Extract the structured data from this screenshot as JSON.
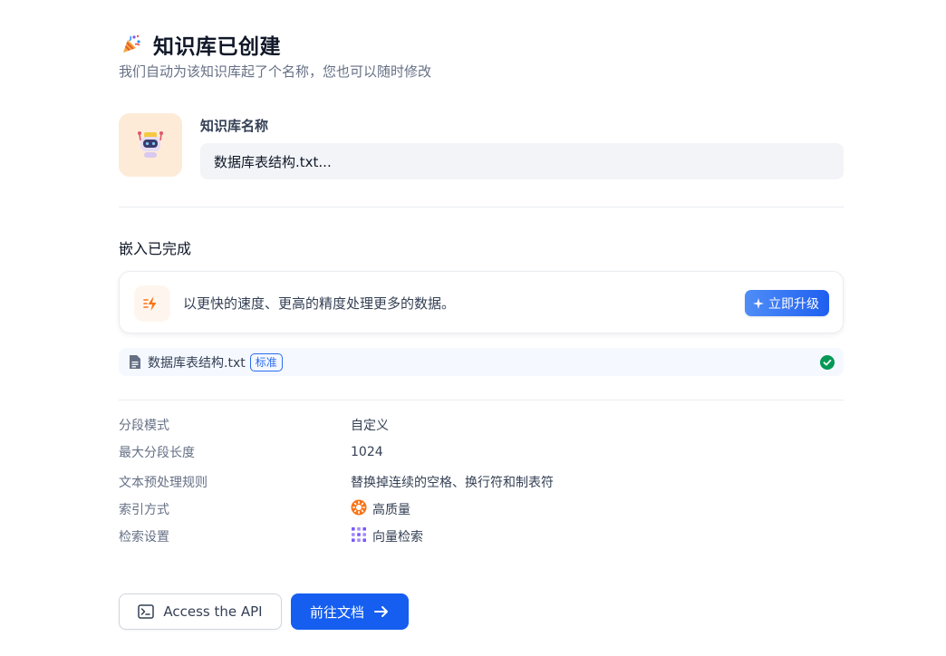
{
  "header": {
    "title": "知识库已创建",
    "subtitle": "我们自动为该知识库起了个名称，您也可以随时修改",
    "icon": "party-popper-icon"
  },
  "name_section": {
    "label": "知识库名称",
    "value": "数据库表结构.txt...",
    "avatar_icon": "robot-icon",
    "avatar_bg": "#fdebd8"
  },
  "embedding": {
    "title": "嵌入已完成",
    "upgrade_text": "以更快的速度、更高的精度处理更多的数据。",
    "upgrade_button": "立即升级"
  },
  "file": {
    "name": "数据库表结构.txt",
    "badge": "标准",
    "status": "completed"
  },
  "settings": [
    {
      "key": "分段模式",
      "value": "自定义"
    },
    {
      "key": "最大分段长度",
      "value": "1024"
    },
    {
      "key": "文本预处理规则",
      "value": "替换掉连续的空格、换行符和制表符"
    },
    {
      "key": "索引方式",
      "value": "高质量",
      "icon": "high-quality-icon"
    },
    {
      "key": "检索设置",
      "value": "向量检索",
      "icon": "vector-search-icon"
    }
  ],
  "actions": {
    "api_button": "Access the API",
    "docs_button": "前往文档"
  },
  "colors": {
    "primary": "#155eef",
    "success": "#039855",
    "warning": "#f79009"
  }
}
